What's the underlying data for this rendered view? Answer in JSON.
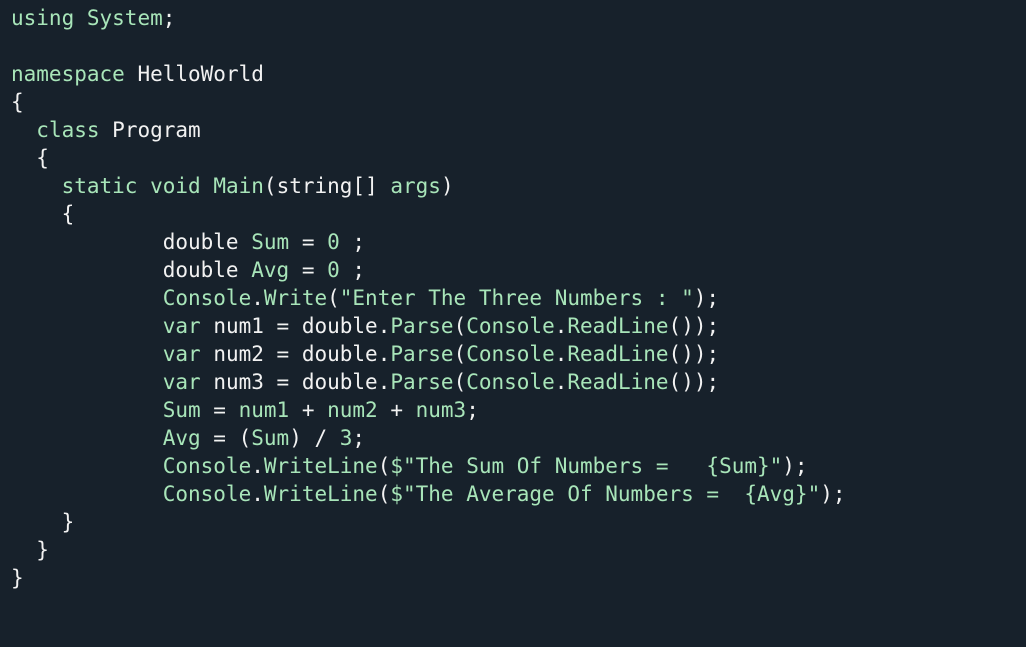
{
  "colors": {
    "background": "#17212b",
    "keyword": "#a8e5b9",
    "default": "#f2f2f2",
    "string": "#a8e5b9",
    "number": "#a8e5b9",
    "identifier": "#a8e5b9",
    "punctuation": "#f2f2f2"
  },
  "code": {
    "language": "C#",
    "lines": [
      {
        "tokens": [
          {
            "text": "using",
            "kind": "keyword"
          },
          {
            "text": " ",
            "kind": "default"
          },
          {
            "text": "System",
            "kind": "identifier"
          },
          {
            "text": ";",
            "kind": "punctuation"
          }
        ]
      },
      {
        "tokens": []
      },
      {
        "tokens": [
          {
            "text": "namespace",
            "kind": "keyword"
          },
          {
            "text": " ",
            "kind": "default"
          },
          {
            "text": "HelloWorld",
            "kind": "default"
          }
        ]
      },
      {
        "tokens": [
          {
            "text": "{",
            "kind": "punctuation"
          }
        ]
      },
      {
        "tokens": [
          {
            "text": "  ",
            "kind": "default"
          },
          {
            "text": "class",
            "kind": "keyword"
          },
          {
            "text": " ",
            "kind": "default"
          },
          {
            "text": "Program",
            "kind": "default"
          }
        ]
      },
      {
        "tokens": [
          {
            "text": "  ",
            "kind": "default"
          },
          {
            "text": "{",
            "kind": "punctuation"
          }
        ]
      },
      {
        "tokens": [
          {
            "text": "    ",
            "kind": "default"
          },
          {
            "text": "static",
            "kind": "keyword"
          },
          {
            "text": " ",
            "kind": "default"
          },
          {
            "text": "void",
            "kind": "keyword"
          },
          {
            "text": " ",
            "kind": "default"
          },
          {
            "text": "Main",
            "kind": "identifier"
          },
          {
            "text": "(",
            "kind": "punctuation"
          },
          {
            "text": "string",
            "kind": "default"
          },
          {
            "text": "[] ",
            "kind": "punctuation"
          },
          {
            "text": "args",
            "kind": "identifier"
          },
          {
            "text": ")",
            "kind": "punctuation"
          }
        ]
      },
      {
        "tokens": [
          {
            "text": "    ",
            "kind": "default"
          },
          {
            "text": "{",
            "kind": "punctuation"
          }
        ]
      },
      {
        "tokens": [
          {
            "text": "            ",
            "kind": "default"
          },
          {
            "text": "double",
            "kind": "default"
          },
          {
            "text": " ",
            "kind": "default"
          },
          {
            "text": "Sum",
            "kind": "identifier"
          },
          {
            "text": " = ",
            "kind": "punctuation"
          },
          {
            "text": "0",
            "kind": "number"
          },
          {
            "text": " ;",
            "kind": "punctuation"
          }
        ]
      },
      {
        "tokens": [
          {
            "text": "            ",
            "kind": "default"
          },
          {
            "text": "double",
            "kind": "default"
          },
          {
            "text": " ",
            "kind": "default"
          },
          {
            "text": "Avg",
            "kind": "identifier"
          },
          {
            "text": " = ",
            "kind": "punctuation"
          },
          {
            "text": "0",
            "kind": "number"
          },
          {
            "text": " ;",
            "kind": "punctuation"
          }
        ]
      },
      {
        "tokens": [
          {
            "text": "            ",
            "kind": "default"
          },
          {
            "text": "Console",
            "kind": "identifier"
          },
          {
            "text": ".",
            "kind": "punctuation"
          },
          {
            "text": "Write",
            "kind": "identifier"
          },
          {
            "text": "(",
            "kind": "punctuation"
          },
          {
            "text": "\"Enter The Three Numbers : \"",
            "kind": "string"
          },
          {
            "text": ");",
            "kind": "punctuation"
          }
        ]
      },
      {
        "tokens": [
          {
            "text": "            ",
            "kind": "default"
          },
          {
            "text": "var",
            "kind": "keyword"
          },
          {
            "text": " ",
            "kind": "default"
          },
          {
            "text": "num1",
            "kind": "default"
          },
          {
            "text": " = ",
            "kind": "punctuation"
          },
          {
            "text": "double",
            "kind": "default"
          },
          {
            "text": ".",
            "kind": "punctuation"
          },
          {
            "text": "Parse",
            "kind": "identifier"
          },
          {
            "text": "(",
            "kind": "punctuation"
          },
          {
            "text": "Console",
            "kind": "identifier"
          },
          {
            "text": ".",
            "kind": "punctuation"
          },
          {
            "text": "ReadLine",
            "kind": "identifier"
          },
          {
            "text": "());",
            "kind": "punctuation"
          }
        ]
      },
      {
        "tokens": [
          {
            "text": "            ",
            "kind": "default"
          },
          {
            "text": "var",
            "kind": "keyword"
          },
          {
            "text": " ",
            "kind": "default"
          },
          {
            "text": "num2",
            "kind": "default"
          },
          {
            "text": " = ",
            "kind": "punctuation"
          },
          {
            "text": "double",
            "kind": "default"
          },
          {
            "text": ".",
            "kind": "punctuation"
          },
          {
            "text": "Parse",
            "kind": "identifier"
          },
          {
            "text": "(",
            "kind": "punctuation"
          },
          {
            "text": "Console",
            "kind": "identifier"
          },
          {
            "text": ".",
            "kind": "punctuation"
          },
          {
            "text": "ReadLine",
            "kind": "identifier"
          },
          {
            "text": "());",
            "kind": "punctuation"
          }
        ]
      },
      {
        "tokens": [
          {
            "text": "            ",
            "kind": "default"
          },
          {
            "text": "var",
            "kind": "keyword"
          },
          {
            "text": " ",
            "kind": "default"
          },
          {
            "text": "num3",
            "kind": "default"
          },
          {
            "text": " = ",
            "kind": "punctuation"
          },
          {
            "text": "double",
            "kind": "default"
          },
          {
            "text": ".",
            "kind": "punctuation"
          },
          {
            "text": "Parse",
            "kind": "identifier"
          },
          {
            "text": "(",
            "kind": "punctuation"
          },
          {
            "text": "Console",
            "kind": "identifier"
          },
          {
            "text": ".",
            "kind": "punctuation"
          },
          {
            "text": "ReadLine",
            "kind": "identifier"
          },
          {
            "text": "());",
            "kind": "punctuation"
          }
        ]
      },
      {
        "tokens": [
          {
            "text": "            ",
            "kind": "default"
          },
          {
            "text": "Sum",
            "kind": "identifier"
          },
          {
            "text": " = ",
            "kind": "punctuation"
          },
          {
            "text": "num1",
            "kind": "identifier"
          },
          {
            "text": " + ",
            "kind": "punctuation"
          },
          {
            "text": "num2",
            "kind": "identifier"
          },
          {
            "text": " + ",
            "kind": "punctuation"
          },
          {
            "text": "num3",
            "kind": "identifier"
          },
          {
            "text": ";",
            "kind": "punctuation"
          }
        ]
      },
      {
        "tokens": [
          {
            "text": "            ",
            "kind": "default"
          },
          {
            "text": "Avg",
            "kind": "identifier"
          },
          {
            "text": " = ",
            "kind": "punctuation"
          },
          {
            "text": "(",
            "kind": "punctuation"
          },
          {
            "text": "Sum",
            "kind": "identifier"
          },
          {
            "text": ") / ",
            "kind": "punctuation"
          },
          {
            "text": "3",
            "kind": "number"
          },
          {
            "text": ";",
            "kind": "punctuation"
          }
        ]
      },
      {
        "tokens": [
          {
            "text": "            ",
            "kind": "default"
          },
          {
            "text": "Console",
            "kind": "identifier"
          },
          {
            "text": ".",
            "kind": "punctuation"
          },
          {
            "text": "WriteLine",
            "kind": "identifier"
          },
          {
            "text": "(",
            "kind": "punctuation"
          },
          {
            "text": "$\"The Sum Of Numbers =   {Sum}\"",
            "kind": "string"
          },
          {
            "text": ");",
            "kind": "punctuation"
          }
        ]
      },
      {
        "tokens": [
          {
            "text": "            ",
            "kind": "default"
          },
          {
            "text": "Console",
            "kind": "identifier"
          },
          {
            "text": ".",
            "kind": "punctuation"
          },
          {
            "text": "WriteLine",
            "kind": "identifier"
          },
          {
            "text": "(",
            "kind": "punctuation"
          },
          {
            "text": "$\"The Average Of Numbers =  {Avg}\"",
            "kind": "string"
          },
          {
            "text": ");",
            "kind": "punctuation"
          }
        ]
      },
      {
        "tokens": [
          {
            "text": "    ",
            "kind": "default"
          },
          {
            "text": "}",
            "kind": "punctuation"
          }
        ]
      },
      {
        "tokens": [
          {
            "text": "  ",
            "kind": "default"
          },
          {
            "text": "}",
            "kind": "punctuation"
          }
        ]
      },
      {
        "tokens": [
          {
            "text": "}",
            "kind": "punctuation"
          }
        ]
      }
    ]
  }
}
